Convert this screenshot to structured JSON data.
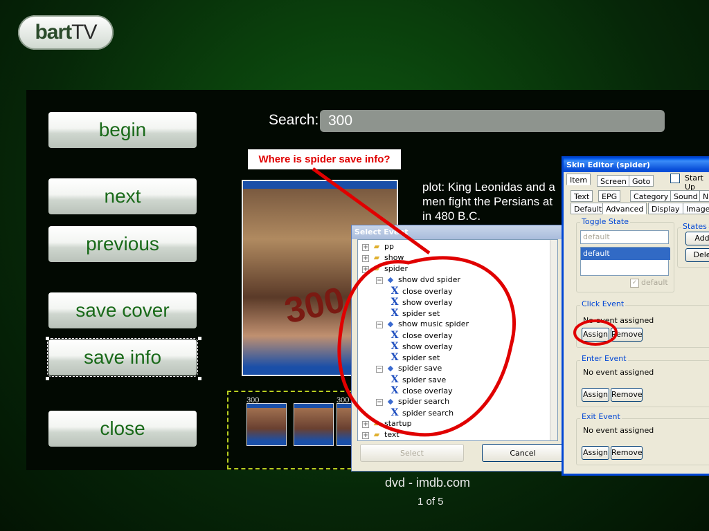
{
  "app": {
    "logo_bold": "bart",
    "logo_light": "TV"
  },
  "nav": {
    "begin": "begin",
    "next": "next",
    "previous": "previous",
    "save_cover": "save cover",
    "save_info": "save info",
    "close": "close"
  },
  "search": {
    "label": "Search:",
    "value": "300"
  },
  "movie": {
    "poster_text": "300",
    "plot_lines": [
      "plot: King Leonidas and a",
      "men fight the Persians at",
      "in 480 B.C."
    ],
    "thumb_labels": [
      "300",
      "300"
    ],
    "source": "dvd - imdb.com",
    "pager": "1 of 5"
  },
  "annotation": {
    "text": "Where is spider save info?",
    "color": "#e00000"
  },
  "select_event": {
    "title": "Select Event",
    "tree": [
      {
        "label": "pp",
        "icon": "folder",
        "depth": 0
      },
      {
        "label": "show",
        "icon": "folder",
        "depth": 0
      },
      {
        "label": "spider",
        "icon": "folder",
        "depth": 0
      },
      {
        "label": "show dvd spider",
        "icon": "diamond",
        "depth": 1
      },
      {
        "label": "close overlay",
        "icon": "x",
        "depth": 2
      },
      {
        "label": "show overlay",
        "icon": "x",
        "depth": 2
      },
      {
        "label": "spider set",
        "icon": "x",
        "depth": 2
      },
      {
        "label": "show music spider",
        "icon": "diamond",
        "depth": 1
      },
      {
        "label": "close overlay",
        "icon": "x",
        "depth": 2
      },
      {
        "label": "show overlay",
        "icon": "x",
        "depth": 2
      },
      {
        "label": "spider set",
        "icon": "x",
        "depth": 2
      },
      {
        "label": "spider save",
        "icon": "diamond",
        "depth": 1
      },
      {
        "label": "spider save",
        "icon": "x",
        "depth": 2
      },
      {
        "label": "close overlay",
        "icon": "x",
        "depth": 2
      },
      {
        "label": "spider search",
        "icon": "diamond",
        "depth": 1
      },
      {
        "label": "spider search",
        "icon": "x",
        "depth": 2
      },
      {
        "label": "startup",
        "icon": "folder",
        "depth": 0
      },
      {
        "label": "text",
        "icon": "folder",
        "depth": 0
      }
    ],
    "select_button": "Select",
    "cancel_button": "Cancel"
  },
  "skin_editor": {
    "title": "Skin Editor (spider)",
    "start_up_label": "Start Up",
    "tabs_row1": [
      "Item",
      "Screen",
      "Goto"
    ],
    "tabs_row2": [
      "Text",
      "EPG",
      "Category",
      "Sound",
      "N"
    ],
    "tabs_row3": [
      "Default",
      "Advanced",
      "Display",
      "Image"
    ],
    "toggle_state": {
      "label": "Toggle State",
      "field_value": "default",
      "list_item": "default",
      "checkbox_label": "default"
    },
    "states": {
      "label": "States",
      "add_button": "Add",
      "delete_button": "Dele"
    },
    "click_event": {
      "label": "Click Event",
      "status": "No event assigned",
      "assign": "Assign",
      "remove": "Remove"
    },
    "enter_event": {
      "label": "Enter Event",
      "status": "No event assigned",
      "assign": "Assign",
      "remove": "Remove"
    },
    "exit_event": {
      "label": "Exit Event",
      "status": "No event assigned",
      "assign": "Assign",
      "remove": "Remove"
    }
  }
}
